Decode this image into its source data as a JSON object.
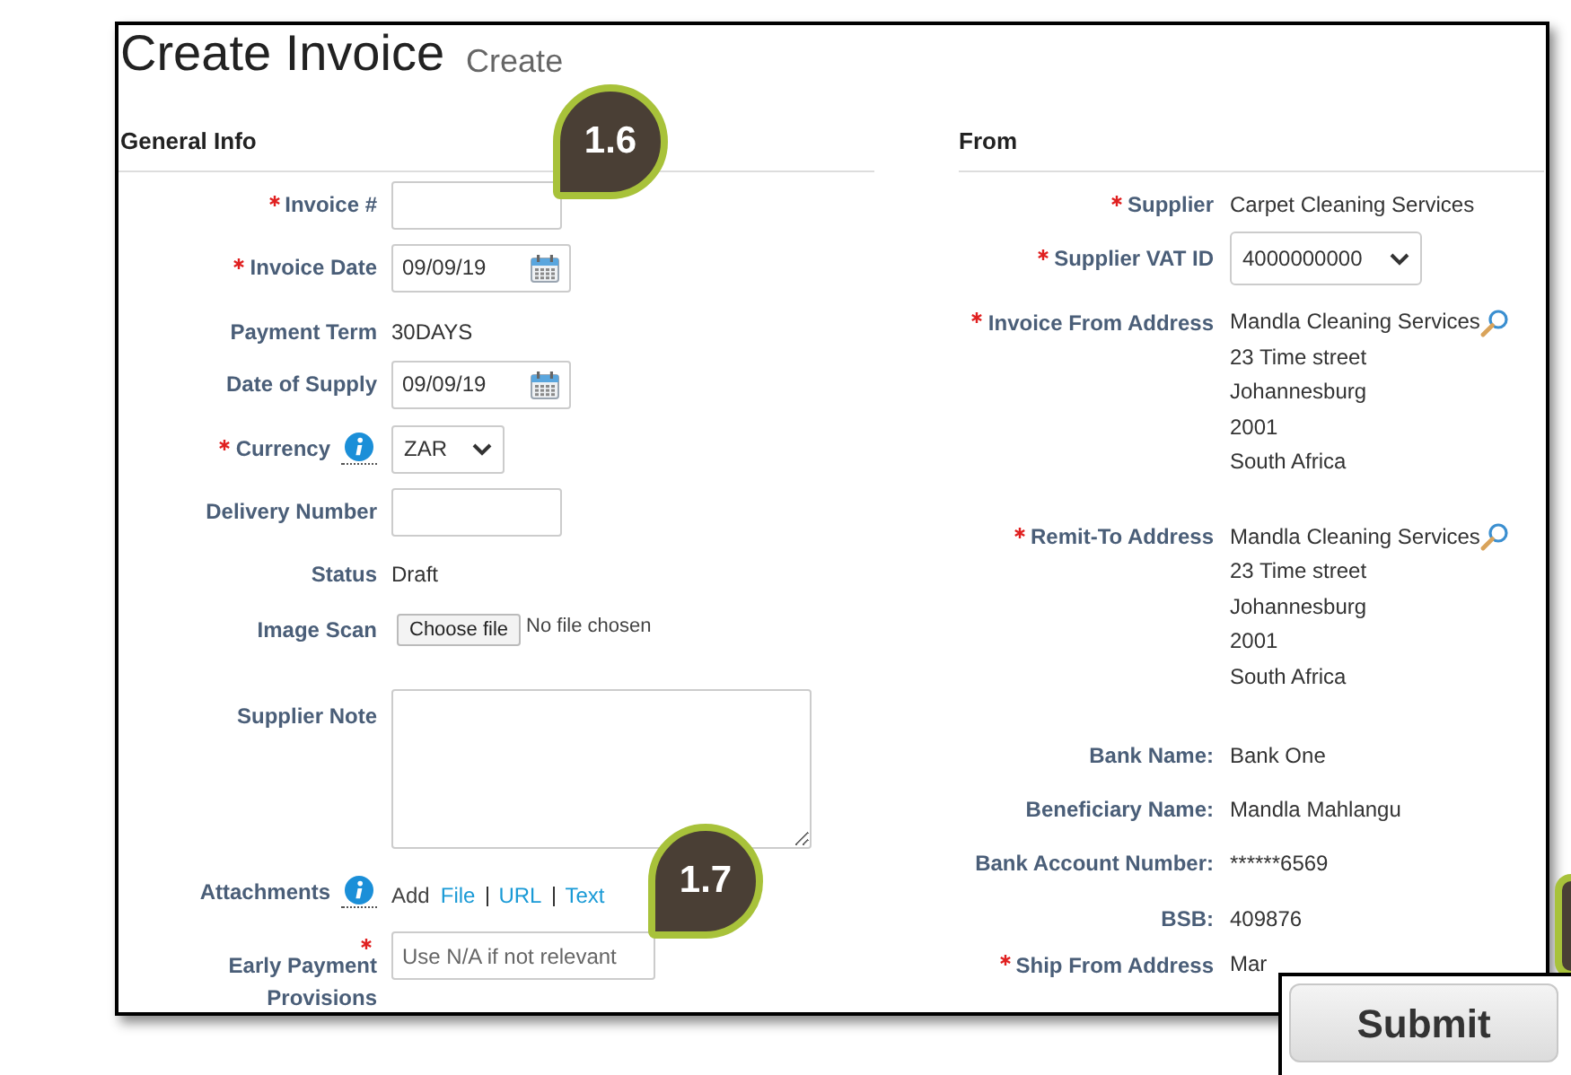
{
  "title": "Create Invoice",
  "subtitle": "Create",
  "general_info": {
    "heading": "General Info",
    "fields": [
      {
        "kind": "input",
        "label": "Invoice #",
        "required": true,
        "info": false
      },
      {
        "kind": "date",
        "label": "Invoice Date",
        "required": true,
        "info": false,
        "value": "09/09/19"
      },
      {
        "kind": "text",
        "label": "Payment Term",
        "required": false,
        "info": false,
        "value": "30DAYS"
      },
      {
        "kind": "date",
        "label": "Date of Supply",
        "required": false,
        "info": false,
        "value": "09/09/19"
      },
      {
        "kind": "select",
        "label": "Currency",
        "required": true,
        "info": true,
        "value": "ZAR"
      },
      {
        "kind": "input",
        "label": "Delivery Number",
        "required": false,
        "info": false
      },
      {
        "kind": "text",
        "label": "Status",
        "required": false,
        "info": false,
        "value": "Draft"
      },
      {
        "kind": "file",
        "label": "Image Scan",
        "required": false,
        "info": false,
        "button": "Choose file",
        "value": "No file chosen"
      },
      {
        "kind": "textarea",
        "label": "Supplier Note",
        "required": false,
        "info": false
      },
      {
        "kind": "links",
        "label": "Attachments",
        "required": false,
        "info": true,
        "prefix": "Add",
        "links": [
          "File",
          "URL",
          "Text"
        ]
      },
      {
        "kind": "input",
        "label": "Early Payment Provisions",
        "required": true,
        "info": false,
        "placeholder": "Use N/A if not relevant"
      }
    ]
  },
  "from": {
    "heading": "From",
    "fields": [
      {
        "kind": "text",
        "label": "Supplier",
        "required": true,
        "value": "Carpet Cleaning Services"
      },
      {
        "kind": "select",
        "label": "Supplier VAT ID",
        "required": true,
        "value": "4000000000"
      },
      {
        "kind": "address",
        "label": "Invoice From Address",
        "required": true,
        "search": true,
        "lines": [
          "Mandla Cleaning Services",
          "23 Time street",
          "Johannesburg",
          "2001",
          "South Africa"
        ]
      },
      {
        "kind": "address",
        "label": "Remit-To Address",
        "required": true,
        "search": true,
        "lines": [
          "Mandla Cleaning Services",
          "23 Time street",
          "Johannesburg",
          "2001",
          "South Africa"
        ]
      },
      {
        "kind": "text",
        "label": "Bank Name:",
        "required": false,
        "value": "Bank One"
      },
      {
        "kind": "text",
        "label": "Beneficiary Name:",
        "required": false,
        "value": "Mandla Mahlangu"
      },
      {
        "kind": "text",
        "label": "Bank Account Number:",
        "required": false,
        "value": "******6569"
      },
      {
        "kind": "text",
        "label": "BSB:",
        "required": false,
        "value": "409876"
      },
      {
        "kind": "address",
        "label": "Ship From Address",
        "required": true,
        "search": false,
        "lines": [
          "Mar"
        ]
      }
    ]
  },
  "callouts": [
    {
      "label": "1.6"
    },
    {
      "label": "1.7"
    }
  ],
  "submit": {
    "label": "Submit"
  }
}
